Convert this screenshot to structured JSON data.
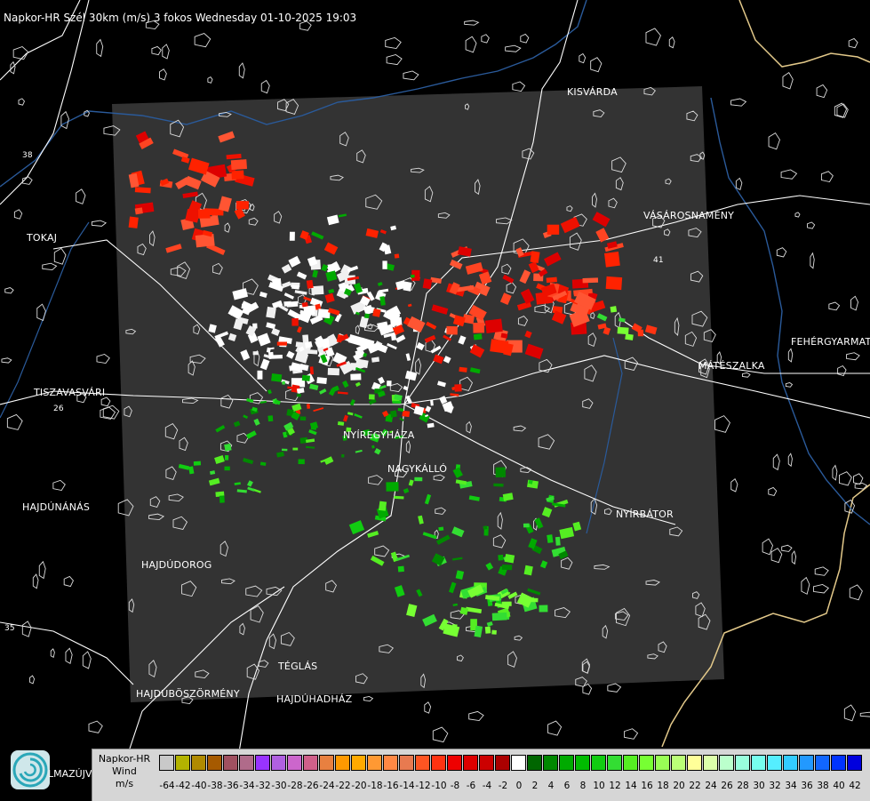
{
  "title": "Napkor-HR Szél 30km (m/s) 3 fokos Wednesday 01-10-2025 19:03",
  "towns": [
    {
      "key": "kisvarda",
      "name": "KISVÁRDA"
    },
    {
      "key": "tokaj",
      "name": "TOKAJ"
    },
    {
      "key": "vasarosnameny",
      "name": "VÁSÁROSNAMÉNY"
    },
    {
      "key": "fehergyarmat",
      "name": "FEHÉRGYARMAT"
    },
    {
      "key": "mateszalka",
      "name": "MÁTÉSZALKA"
    },
    {
      "key": "tiszavasvari",
      "name": "TISZAVASVÁRI"
    },
    {
      "key": "nyiregyhaza",
      "name": "NYÍREGYHÁZA"
    },
    {
      "key": "nagykallo",
      "name": "NAGYKÁLLÓ"
    },
    {
      "key": "hajdunanas",
      "name": "HAJDÚNÁNÁS"
    },
    {
      "key": "nyirbator",
      "name": "NYÍRBÁTOR"
    },
    {
      "key": "hajdudorog",
      "name": "HAJDÚDOROG"
    },
    {
      "key": "teglas",
      "name": "TÉGLÁS"
    },
    {
      "key": "hajduboszormeny",
      "name": "HAJDÚBÖSZÖRMÉNY"
    },
    {
      "key": "hajduhadhaz",
      "name": "HAJDÚHADHÁZ"
    }
  ],
  "road_numbers": [
    "38",
    "26",
    "41",
    "35"
  ],
  "logo_text": "LMAZÚJVÁR",
  "legend": {
    "line1": "Napkor-HR",
    "line2": "Wind",
    "line3": "m/s",
    "colors": [
      "#c9c9c9",
      "#b3b300",
      "#b08a00",
      "#a65a00",
      "#a05060",
      "#b06b8a",
      "#9933ff",
      "#b060e0",
      "#cc66cc",
      "#d0608a",
      "#e88040",
      "#ff9900",
      "#ffaa00",
      "#ff9933",
      "#ff8844",
      "#e87a50",
      "#ff5522",
      "#ff3311",
      "#ee0000",
      "#dd0000",
      "#cc0000",
      "#aa0000",
      "#ffffff",
      "#006600",
      "#008800",
      "#00aa00",
      "#00bb00",
      "#11cc11",
      "#33dd33",
      "#55ee22",
      "#77ff33",
      "#99ff55",
      "#bbff77",
      "#ffff99",
      "#ddffaa",
      "#bbffcc",
      "#99ffdd",
      "#77ffee",
      "#55eeff",
      "#33ccff",
      "#2299ff",
      "#1166ff",
      "#0033ff",
      "#0000dd"
    ],
    "ticks": [
      "-64",
      "-42",
      "-40",
      "-38",
      "-36",
      "-34",
      "-32",
      "-30",
      "-28",
      "-26",
      "-24",
      "-22",
      "-20",
      "-18",
      "-16",
      "-14",
      "-12",
      "-10",
      "-8",
      "-6",
      "-4",
      "-2",
      "0",
      "2",
      "4",
      "6",
      "8",
      "10",
      "12",
      "14",
      "16",
      "18",
      "20",
      "22",
      "24",
      "26",
      "28",
      "30",
      "32",
      "34",
      "36",
      "38",
      "40",
      "42"
    ]
  }
}
